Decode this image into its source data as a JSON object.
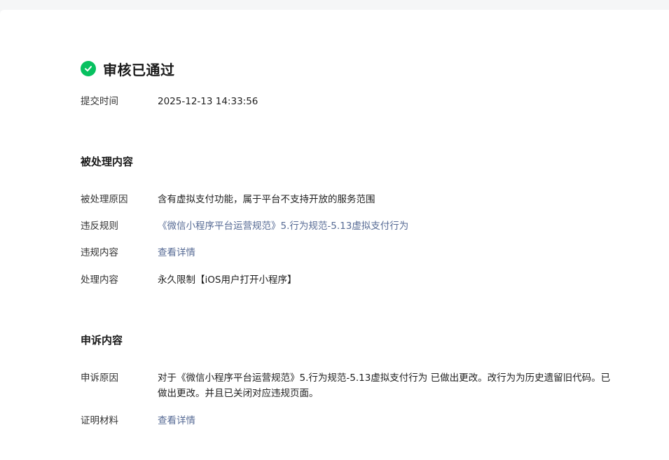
{
  "status": {
    "icon": "check-circle-icon",
    "title": "审核已通过",
    "color": "#07c160"
  },
  "submission": {
    "label": "提交时间",
    "value": "2025-12-13 14:33:56"
  },
  "processed": {
    "title": "被处理内容",
    "reason_label": "被处理原因",
    "reason_value": "含有虚拟支付功能，属于平台不支持开放的服务范围",
    "rule_label": "违反规则",
    "rule_value": "《微信小程序平台运营规范》5.行为规范-5.13虚拟支付行为",
    "violation_label": "违规内容",
    "violation_value": "查看详情",
    "handling_label": "处理内容",
    "handling_value": "永久限制【iOS用户打开小程序】"
  },
  "appeal": {
    "title": "申诉内容",
    "reason_label": "申诉原因",
    "reason_value": "对于《微信小程序平台运营规范》5.行为规范-5.13虚拟支付行为 已做出更改。改行为为历史遗留旧代码。已做出更改。并且已关闭对应违规页面。",
    "proof_label": "证明材料",
    "proof_value": "查看详情"
  },
  "colors": {
    "link": "#576b95",
    "success": "#07c160"
  }
}
